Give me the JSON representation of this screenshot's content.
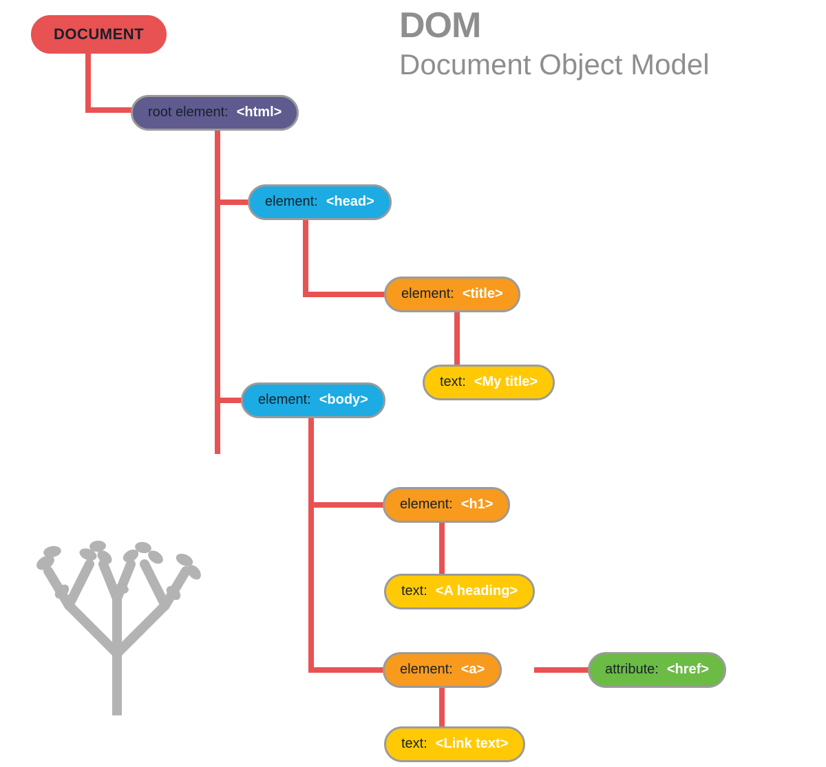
{
  "header": {
    "title": "DOM",
    "subtitle": "Document Object Model"
  },
  "nodes": {
    "document": {
      "label": "DOCUMENT"
    },
    "html": {
      "label": "root element:",
      "tag": "<html>"
    },
    "head": {
      "label": "element:",
      "tag": "<head>"
    },
    "title": {
      "label": "element:",
      "tag": "<title>"
    },
    "title_text": {
      "label": "text:",
      "tag": "<My title>"
    },
    "body": {
      "label": "element:",
      "tag": "<body>"
    },
    "h1": {
      "label": "element:",
      "tag": "<h1>"
    },
    "h1_text": {
      "label": "text:",
      "tag": "<A heading>"
    },
    "a": {
      "label": "element:",
      "tag": "<a>"
    },
    "href": {
      "label": "attribute:",
      "tag": "<href>"
    },
    "a_text": {
      "label": "text:",
      "tag": "<Link text>"
    }
  },
  "colors": {
    "connector": "#e95252",
    "border": "#9b9b9b",
    "purple": "#5f5b8f",
    "blue": "#1cabe2",
    "orange": "#f79a1d",
    "yellow": "#ffca05",
    "green": "#6bbb45",
    "gray_text": "#8e8e8e"
  }
}
